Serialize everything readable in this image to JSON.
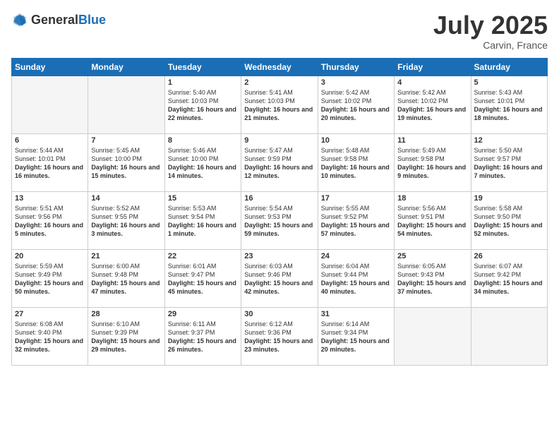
{
  "header": {
    "logo_general": "General",
    "logo_blue": "Blue",
    "title": "July 2025",
    "subtitle": "Carvin, France"
  },
  "weekdays": [
    "Sunday",
    "Monday",
    "Tuesday",
    "Wednesday",
    "Thursday",
    "Friday",
    "Saturday"
  ],
  "weeks": [
    [
      {
        "day": "",
        "empty": true
      },
      {
        "day": "",
        "empty": true
      },
      {
        "day": "1",
        "sunrise": "5:40 AM",
        "sunset": "10:03 PM",
        "daylight": "16 hours and 22 minutes."
      },
      {
        "day": "2",
        "sunrise": "5:41 AM",
        "sunset": "10:03 PM",
        "daylight": "16 hours and 21 minutes."
      },
      {
        "day": "3",
        "sunrise": "5:42 AM",
        "sunset": "10:02 PM",
        "daylight": "16 hours and 20 minutes."
      },
      {
        "day": "4",
        "sunrise": "5:42 AM",
        "sunset": "10:02 PM",
        "daylight": "16 hours and 19 minutes."
      },
      {
        "day": "5",
        "sunrise": "5:43 AM",
        "sunset": "10:01 PM",
        "daylight": "16 hours and 18 minutes."
      }
    ],
    [
      {
        "day": "6",
        "sunrise": "5:44 AM",
        "sunset": "10:01 PM",
        "daylight": "16 hours and 16 minutes."
      },
      {
        "day": "7",
        "sunrise": "5:45 AM",
        "sunset": "10:00 PM",
        "daylight": "16 hours and 15 minutes."
      },
      {
        "day": "8",
        "sunrise": "5:46 AM",
        "sunset": "10:00 PM",
        "daylight": "16 hours and 14 minutes."
      },
      {
        "day": "9",
        "sunrise": "5:47 AM",
        "sunset": "9:59 PM",
        "daylight": "16 hours and 12 minutes."
      },
      {
        "day": "10",
        "sunrise": "5:48 AM",
        "sunset": "9:58 PM",
        "daylight": "16 hours and 10 minutes."
      },
      {
        "day": "11",
        "sunrise": "5:49 AM",
        "sunset": "9:58 PM",
        "daylight": "16 hours and 9 minutes."
      },
      {
        "day": "12",
        "sunrise": "5:50 AM",
        "sunset": "9:57 PM",
        "daylight": "16 hours and 7 minutes."
      }
    ],
    [
      {
        "day": "13",
        "sunrise": "5:51 AM",
        "sunset": "9:56 PM",
        "daylight": "16 hours and 5 minutes."
      },
      {
        "day": "14",
        "sunrise": "5:52 AM",
        "sunset": "9:55 PM",
        "daylight": "16 hours and 3 minutes."
      },
      {
        "day": "15",
        "sunrise": "5:53 AM",
        "sunset": "9:54 PM",
        "daylight": "16 hours and 1 minute."
      },
      {
        "day": "16",
        "sunrise": "5:54 AM",
        "sunset": "9:53 PM",
        "daylight": "15 hours and 59 minutes."
      },
      {
        "day": "17",
        "sunrise": "5:55 AM",
        "sunset": "9:52 PM",
        "daylight": "15 hours and 57 minutes."
      },
      {
        "day": "18",
        "sunrise": "5:56 AM",
        "sunset": "9:51 PM",
        "daylight": "15 hours and 54 minutes."
      },
      {
        "day": "19",
        "sunrise": "5:58 AM",
        "sunset": "9:50 PM",
        "daylight": "15 hours and 52 minutes."
      }
    ],
    [
      {
        "day": "20",
        "sunrise": "5:59 AM",
        "sunset": "9:49 PM",
        "daylight": "15 hours and 50 minutes."
      },
      {
        "day": "21",
        "sunrise": "6:00 AM",
        "sunset": "9:48 PM",
        "daylight": "15 hours and 47 minutes."
      },
      {
        "day": "22",
        "sunrise": "6:01 AM",
        "sunset": "9:47 PM",
        "daylight": "15 hours and 45 minutes."
      },
      {
        "day": "23",
        "sunrise": "6:03 AM",
        "sunset": "9:46 PM",
        "daylight": "15 hours and 42 minutes."
      },
      {
        "day": "24",
        "sunrise": "6:04 AM",
        "sunset": "9:44 PM",
        "daylight": "15 hours and 40 minutes."
      },
      {
        "day": "25",
        "sunrise": "6:05 AM",
        "sunset": "9:43 PM",
        "daylight": "15 hours and 37 minutes."
      },
      {
        "day": "26",
        "sunrise": "6:07 AM",
        "sunset": "9:42 PM",
        "daylight": "15 hours and 34 minutes."
      }
    ],
    [
      {
        "day": "27",
        "sunrise": "6:08 AM",
        "sunset": "9:40 PM",
        "daylight": "15 hours and 32 minutes."
      },
      {
        "day": "28",
        "sunrise": "6:10 AM",
        "sunset": "9:39 PM",
        "daylight": "15 hours and 29 minutes."
      },
      {
        "day": "29",
        "sunrise": "6:11 AM",
        "sunset": "9:37 PM",
        "daylight": "15 hours and 26 minutes."
      },
      {
        "day": "30",
        "sunrise": "6:12 AM",
        "sunset": "9:36 PM",
        "daylight": "15 hours and 23 minutes."
      },
      {
        "day": "31",
        "sunrise": "6:14 AM",
        "sunset": "9:34 PM",
        "daylight": "15 hours and 20 minutes."
      },
      {
        "day": "",
        "empty": true
      },
      {
        "day": "",
        "empty": true
      }
    ]
  ]
}
